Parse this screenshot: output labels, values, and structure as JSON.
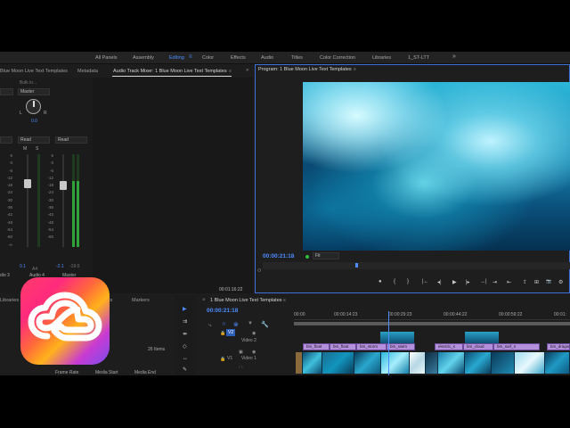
{
  "workspaces": {
    "items": [
      "All Panels",
      "Assembly",
      "Editing",
      "Color",
      "Effects",
      "Audio",
      "Titles",
      "Color Correction",
      "Libraries",
      "1_ST-LTT"
    ],
    "active": "Editing",
    "more": "»"
  },
  "mixer_panel": {
    "tabs": [
      "Blue Moon Live Text Templates",
      "Metadata",
      "Audio Track Mixer: 1 Blue Moon Live Text Templates"
    ],
    "selected_tab": "Audio Track Mixer: 1 Blue Moon Live Text Templates",
    "master_dropdown": "Master",
    "bulk_label": "Bulk in...",
    "knob_left": "L",
    "knob_right": "R",
    "knob_value": "0.0",
    "read_left": "Read",
    "read_right": "Read",
    "mute_buttons": [
      "M",
      "S"
    ],
    "scale": [
      "6",
      "0",
      "-6",
      "-12",
      "-18",
      "-24",
      "-30",
      "-36",
      "-42",
      "-48",
      "-54",
      "-60",
      "-∞"
    ],
    "scale2": [
      "6",
      "0",
      "-6",
      "-12",
      "-18",
      "-24",
      "-30",
      "-36",
      "-42",
      "-48",
      "-54",
      "-60"
    ],
    "values": [
      "0.1",
      "-2.1",
      "-19.0"
    ],
    "channels": [
      "dio 3",
      "Audio 4",
      "Master"
    ],
    "channel_ids": [
      "A4"
    ],
    "timecode": "00:01:16:22"
  },
  "program_monitor": {
    "title": "Program: 1 Blue Moon Live Text Templates",
    "timecode": "00:00:21:18",
    "fit": "Fit",
    "transport": [
      "●",
      "{",
      "}",
      "|←",
      "◂|",
      "▶",
      "|▸",
      "→|",
      "⇥",
      "⇤",
      "⇪",
      "⊞",
      "📷",
      "⚙"
    ]
  },
  "project_panel": {
    "tabs": [
      "Libraries",
      "ts",
      "Markers"
    ],
    "items_count": "26 Items",
    "columns": [
      "Frame Rate",
      "Media Start",
      "Media End"
    ]
  },
  "timeline": {
    "title": "1 Blue Moon Live Text Templates",
    "timecode": "00:00:21:18",
    "ruler": [
      "00:00",
      "00:00:14:23",
      "00:00:29:23",
      "00:00:44:22",
      "00:00:59:22",
      "00:01:"
    ],
    "tracks": [
      {
        "id": "V2",
        "name": "Video 2"
      },
      {
        "id": "V1",
        "name": "Video 1"
      }
    ],
    "v2_clips": [
      "bm_float",
      "bm_float",
      "bm_storm",
      "bm_swim",
      "electric_s",
      "bm_cloud",
      "bm_surf_n",
      "bm_dragon"
    ]
  },
  "colors": {
    "accent": "#4e8cff",
    "panel": "#1d1d1d",
    "clip_v2": "#b48fdc",
    "meter": "#2fa33a"
  },
  "icons": [
    "menu-icon",
    "wrench-icon",
    "marker-icon",
    "link-icon",
    "snap-icon",
    "eye-icon",
    "lock-icon",
    "selection-tool-icon",
    "track-select-icon",
    "ripple-tool-icon",
    "razor-tool-icon",
    "slip-tool-icon",
    "pen-tool-icon",
    "hand-tool-icon",
    "type-tool-icon",
    "creative-cloud-logo"
  ]
}
